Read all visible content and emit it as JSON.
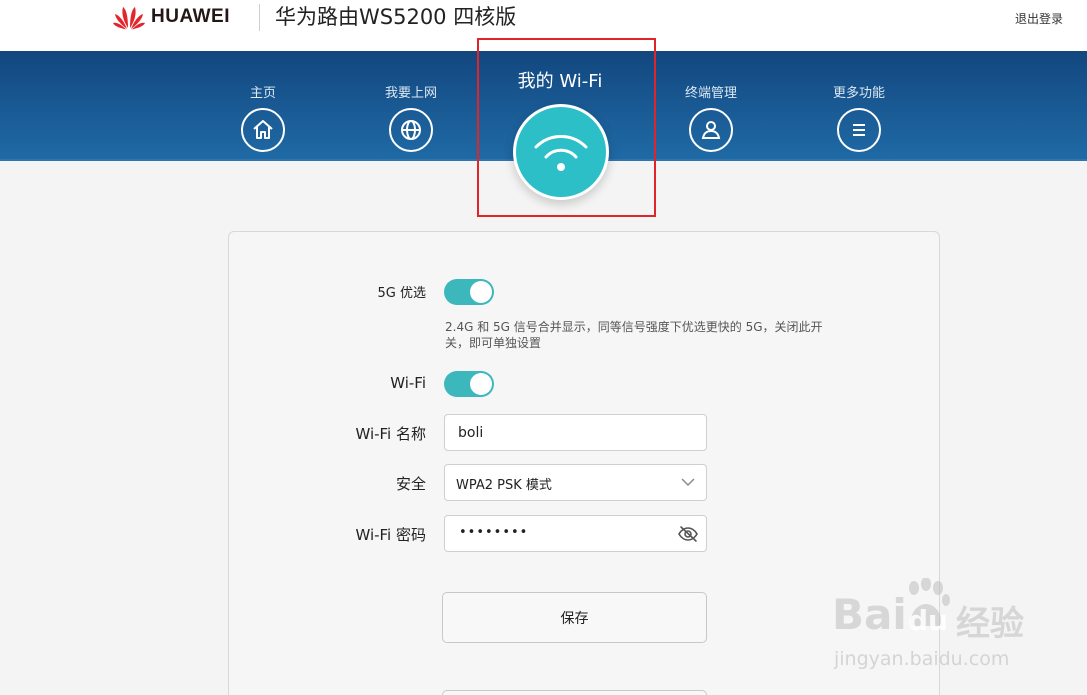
{
  "header": {
    "brand": "HUAWEI",
    "product": "华为路由WS5200 四核版",
    "logout": "退出登录"
  },
  "nav": {
    "items": [
      {
        "label": "主页",
        "icon": "home-icon"
      },
      {
        "label": "我要上网",
        "icon": "globe-icon"
      },
      {
        "label": "我的 Wi-Fi",
        "icon": "wifi-icon",
        "active": true
      },
      {
        "label": "终端管理",
        "icon": "user-icon"
      },
      {
        "label": "更多功能",
        "icon": "menu-icon"
      }
    ]
  },
  "form": {
    "band_pref_label": "5G 优选",
    "band_pref_on": true,
    "band_pref_hint_line1": "2.4G 和 5G 信号合并显示，同等信号强度下优选更快的 5G，关闭此开",
    "band_pref_hint_line2": "关，即可单独设置",
    "wifi_label": "Wi-Fi",
    "wifi_on": true,
    "ssid_label": "Wi-Fi 名称",
    "ssid_value": "boli",
    "security_label": "安全",
    "security_value": "WPA2 PSK 模式",
    "password_label": "Wi-Fi 密码",
    "password_masked": "••••••••",
    "save_label": "保存"
  },
  "watermark": {
    "brand": "Bai",
    "brand2": "du",
    "suffix": "经验",
    "url": "jingyan.baidu.com"
  },
  "colors": {
    "nav_band": "#1a5b95",
    "accent": "#2dbfc8",
    "toggle_on": "#3cb8bd",
    "highlight_box": "#e0242b"
  }
}
